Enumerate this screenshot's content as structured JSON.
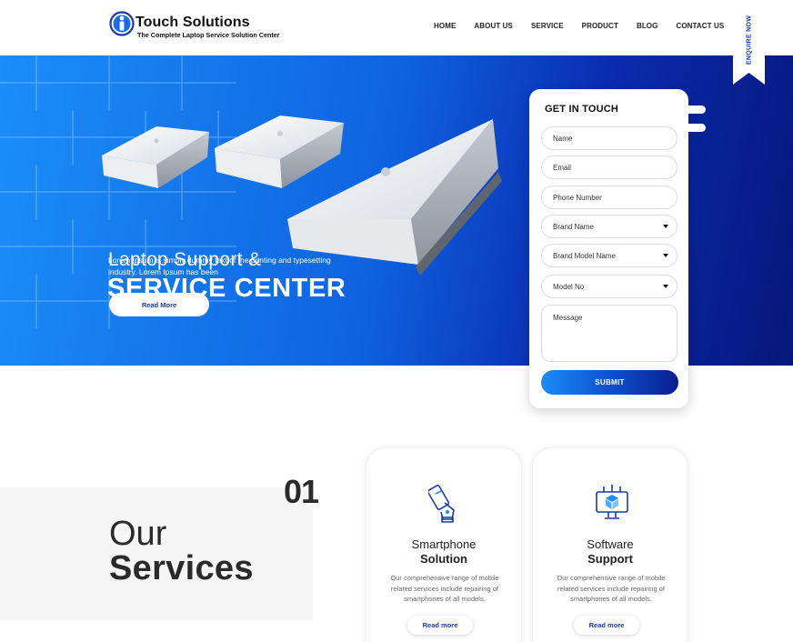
{
  "header": {
    "logo_title": "Touch Solutions",
    "logo_subtitle": "The Complete Laptop Service Solution Center",
    "nav": [
      "HOME",
      "ABOUT US",
      "SERVICE",
      "PRODUCT",
      "BLOG",
      "CONTACT US"
    ],
    "enquire_label": "ENQUIRE NOW"
  },
  "hero": {
    "title_line1": "Laptop Support &",
    "title_line2": "SERVICE CENTER",
    "description": "Lorem Ipsum is simply dummy text of the printing and typesetting industry. Lorem Ipsum has been",
    "read_more": "Read More"
  },
  "form": {
    "title": "GET IN TOUCH",
    "name_placeholder": "Name",
    "email_placeholder": "Email",
    "phone_placeholder": "Phone  Number",
    "brand_name": "Brand Name",
    "brand_model": "Brand Model Name",
    "model_no": "Model No",
    "message_placeholder": "Message",
    "submit": "SUBMIT"
  },
  "services": {
    "number": "01",
    "heading_line1": "Our",
    "heading_line2": "Services",
    "cards": [
      {
        "title_line1": "Smartphone",
        "title_line2": "Solution",
        "description": "Our comprehensive range of mobile related services include repairing of smartphones of all models.",
        "button": "Read more",
        "icon": "smartphone-repair-icon"
      },
      {
        "title_line1": "Software",
        "title_line2": "Support",
        "description": "Our comprehensive range of mobile related services include repairing of smartphones of all models.",
        "button": "Read more",
        "icon": "software-support-icon"
      }
    ]
  },
  "colors": {
    "brand_blue": "#1a3aa8",
    "hero_start": "#1b8ef8",
    "hero_end": "#06177a"
  }
}
